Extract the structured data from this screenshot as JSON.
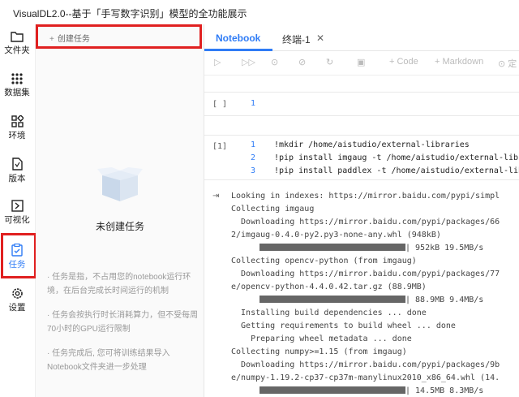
{
  "window": {
    "title": "VisualDL2.0--基于「手写数字识别」模型的全功能展示"
  },
  "sidebar": {
    "items": [
      {
        "label": "文件夹",
        "icon": "folder-icon"
      },
      {
        "label": "数据集",
        "icon": "dataset-grid-icon"
      },
      {
        "label": "环境",
        "icon": "environment-icon"
      },
      {
        "label": "版本",
        "icon": "version-icon"
      },
      {
        "label": "可视化",
        "icon": "visualization-icon"
      },
      {
        "label": "任务",
        "icon": "task-icon",
        "active": true
      },
      {
        "label": "设置",
        "icon": "settings-gear-icon"
      }
    ]
  },
  "task_panel": {
    "create_label": "创建任务",
    "empty_title": "未创建任务",
    "notes": [
      "· 任务是指，不占用您的notebook运行环境，在后台完成长时间运行的机制",
      "· 任务会按执行时长消耗算力，但不受每周70小时的GPU运行限制",
      "· 任务完成后, 您可将训练结果导入Notebook文件夹进一步处理"
    ]
  },
  "tabs": [
    {
      "label": "Notebook",
      "active": true
    },
    {
      "label": "终端-1",
      "closable": true
    }
  ],
  "toolbar": {
    "add_code_label": "+ Code",
    "add_markdown_label": "+ Markdown",
    "truncated_label": "定"
  },
  "cells": [
    {
      "prompt": "[ ]",
      "lines": [
        {
          "no": "1",
          "text": ""
        }
      ]
    },
    {
      "prompt": "[1]",
      "lines": [
        {
          "no": "1",
          "text": "!mkdir /home/aistudio/external-libraries"
        },
        {
          "no": "2",
          "text": "!pip install imgaug -t /home/aistudio/external-libr"
        },
        {
          "no": "3",
          "text": "!pip install paddlex -t /home/aistudio/external-lib"
        }
      ]
    }
  ],
  "output": {
    "lines": [
      {
        "text": "Looking in indexes: https://mirror.baidu.com/pypi/simpl"
      },
      {
        "text": "Collecting imgaug"
      },
      {
        "text": "  Downloading https://mirror.baidu.com/pypi/packages/66"
      },
      {
        "text": "2/imgaug-0.4.0-py2.py3-none-any.whl (948kB)"
      },
      {
        "text": "| 952kB 19.5MB/s",
        "progress": 1.0
      },
      {
        "text": "Collecting opencv-python (from imgaug)"
      },
      {
        "text": "  Downloading https://mirror.baidu.com/pypi/packages/77"
      },
      {
        "text": "e/opencv-python-4.4.0.42.tar.gz (88.9MB)"
      },
      {
        "text": "| 88.9MB 9.4MB/s",
        "progress": 1.0
      },
      {
        "text": "  Installing build dependencies ... done"
      },
      {
        "text": "  Getting requirements to build wheel ... done"
      },
      {
        "text": "    Preparing wheel metadata ... done"
      },
      {
        "text": "Collecting numpy>=1.15 (from imgaug)"
      },
      {
        "text": "  Downloading https://mirror.baidu.com/pypi/packages/9b"
      },
      {
        "text": "e/numpy-1.19.2-cp37-cp37m-manylinux2010_x86_64.whl (14."
      },
      {
        "text": "| 14.5MB 8.3MB/s",
        "progress": 1.0
      }
    ]
  },
  "colors": {
    "accent": "#2f7cf6",
    "highlight_border": "#e02020"
  }
}
